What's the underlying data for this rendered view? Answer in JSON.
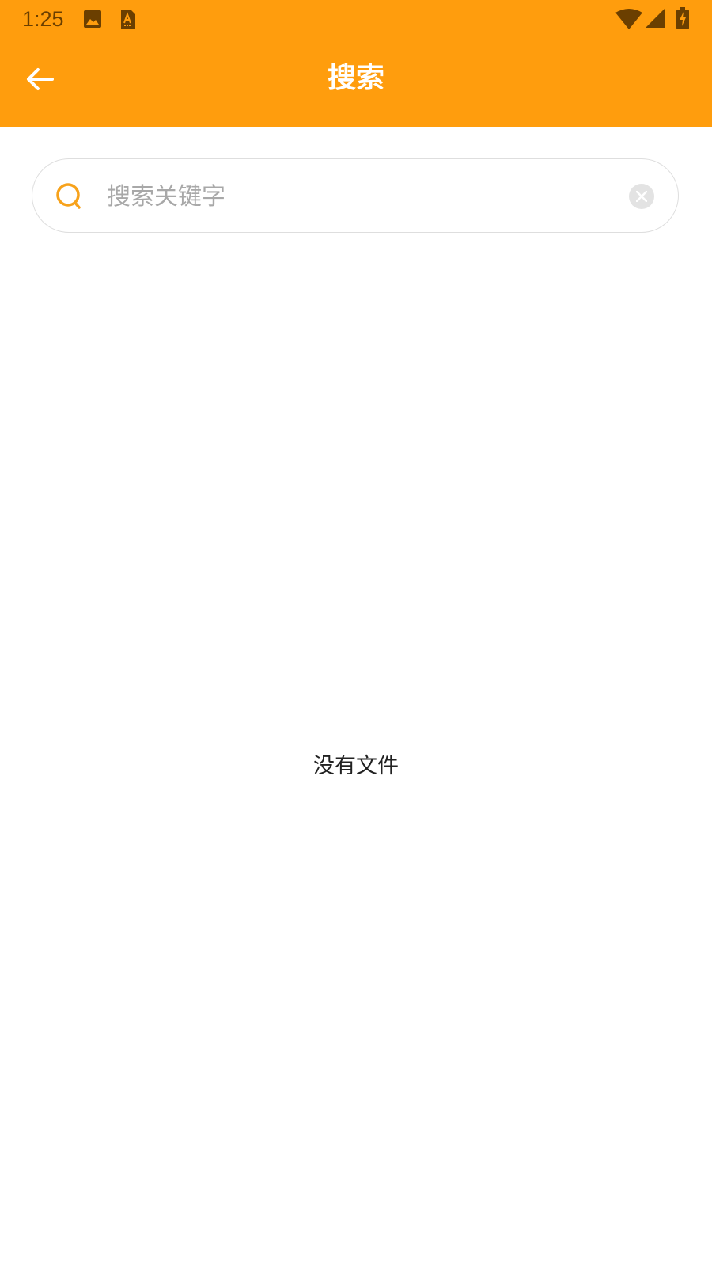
{
  "status_bar": {
    "time": "1:25",
    "left_icons": [
      "image-icon",
      "text-app-icon"
    ],
    "right_icons": [
      "wifi-icon",
      "cell-signal-icon",
      "battery-charging-icon"
    ],
    "text_color": "#6B3F00"
  },
  "app_bar": {
    "title": "搜索",
    "back_icon": "arrow-back-icon",
    "background_color": "#FF9D0D"
  },
  "search": {
    "placeholder": "搜索关键字",
    "value": "",
    "search_icon": "search-icon",
    "clear_icon": "clear-icon",
    "accent_color": "#F7A21B"
  },
  "content": {
    "empty_message": "没有文件"
  }
}
